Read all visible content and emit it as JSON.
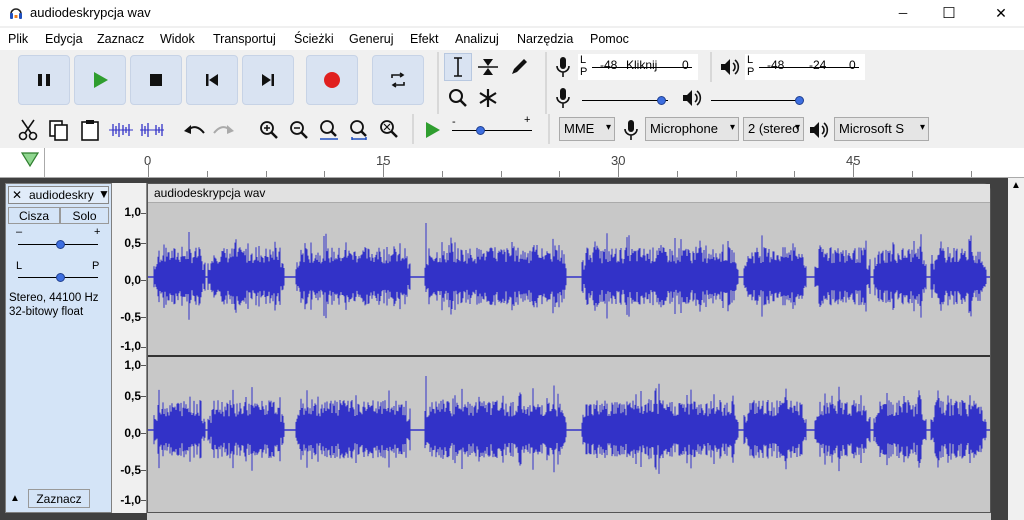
{
  "window": {
    "title": "audiodeskrypcja wav",
    "minimize": "─",
    "maximize": "☐",
    "close": "✕"
  },
  "menu": [
    "Plik",
    "Edycja",
    "Zaznacz",
    "Widok",
    "Transportuj",
    "Ścieżki",
    "Generuj",
    "Efekt",
    "Analizuj",
    "Narzędzia",
    "Pomoc"
  ],
  "meters": {
    "record": {
      "l": "L",
      "r": "P",
      "db1": "-48",
      "click_label": "Kliknij",
      "db2": "0"
    },
    "playback": {
      "l": "L",
      "r": "P",
      "db1": "-48",
      "db2": "-24",
      "db3": "0"
    }
  },
  "devices": {
    "host": "MME",
    "input": "Microphone",
    "channels": "2 (stereo",
    "output": "Microsoft S"
  },
  "ruler": {
    "labels": [
      "0",
      "15",
      "30",
      "45"
    ]
  },
  "track": {
    "name": "audiodeskry",
    "mute": "Cisza",
    "solo": "Solo",
    "gain_minus": "–",
    "gain_plus": "+",
    "pan_left": "L",
    "pan_right": "P",
    "info1": "Stereo, 44100 Hz",
    "info2": "32-bitowy float",
    "select": "Zaznacz",
    "clip_name": "audiodeskrypcja wav"
  },
  "vscale": [
    "1,0",
    "0,5",
    "0,0",
    "-0,5",
    "-1,0"
  ],
  "colors": {
    "waveform": "#3232c8",
    "button": "#d9e3f2",
    "record": "#e02020",
    "play": "#2f9e2f"
  }
}
